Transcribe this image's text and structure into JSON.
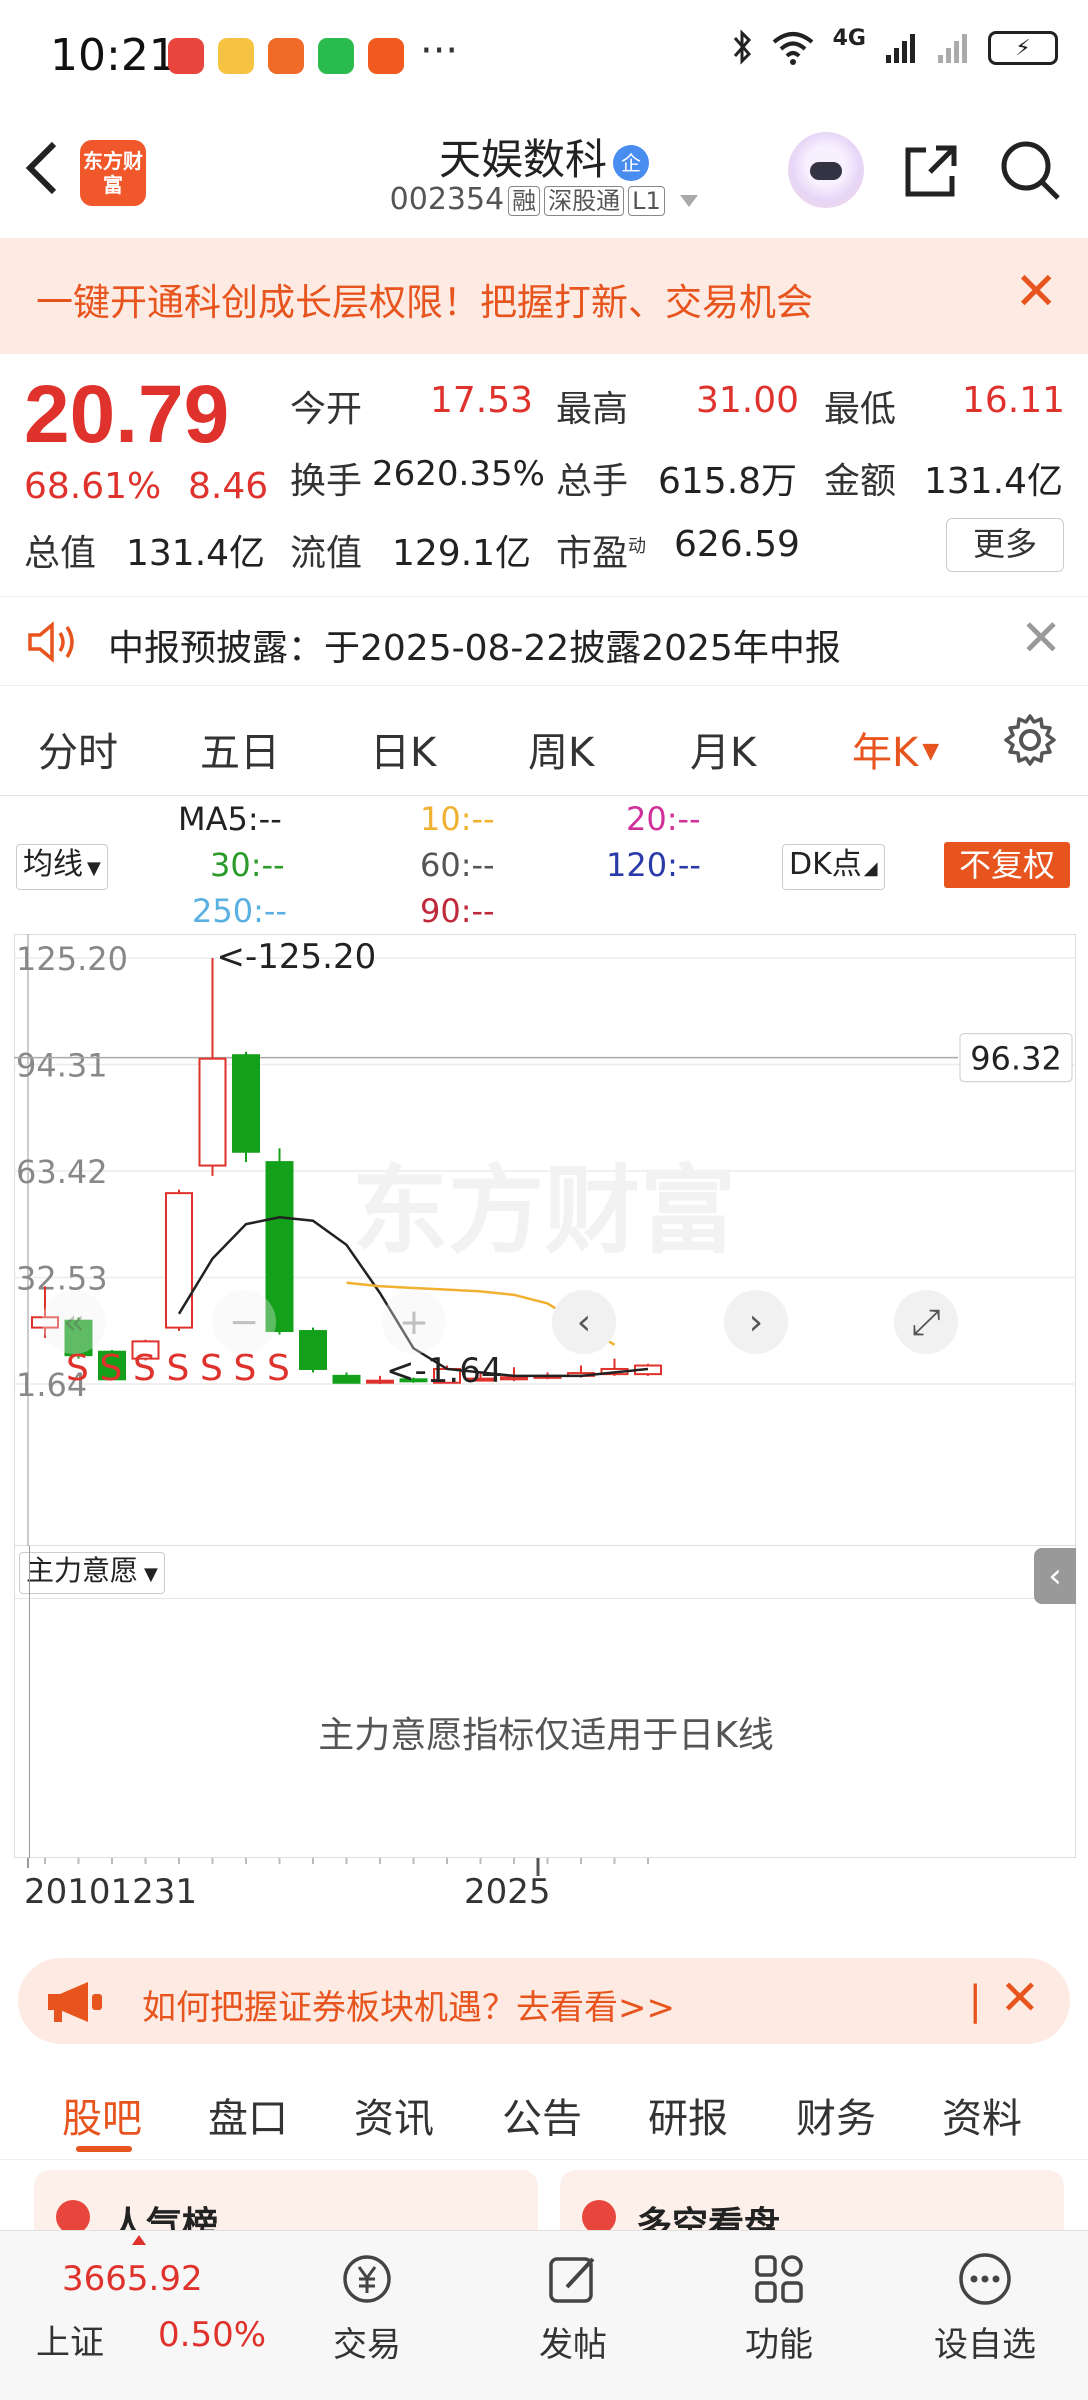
{
  "status_bar": {
    "time": "10:21",
    "more": "···",
    "network": "4G",
    "battery_icon": "battery-charging-icon"
  },
  "header": {
    "logo_text": "东方财富",
    "stock_name": "天娱数科",
    "enterprise_badge": "企",
    "stock_code": "002354",
    "tags": [
      "融",
      "深股通",
      "L1"
    ]
  },
  "banner": {
    "text": "一键开通科创成长层权限！把握打新、交易机会",
    "close": "✕"
  },
  "quote": {
    "price": "20.79",
    "change_pct": "68.61%",
    "change_amt": "8.46",
    "fields": [
      {
        "label": "今开",
        "value": "17.53"
      },
      {
        "label": "最高",
        "value": "31.00"
      },
      {
        "label": "最低",
        "value": "16.11"
      },
      {
        "label": "换手",
        "value": "2620.35%"
      },
      {
        "label": "总手",
        "value": "615.8万"
      },
      {
        "label": "金额",
        "value": "131.4亿"
      },
      {
        "label": "总值",
        "value": "131.4亿"
      },
      {
        "label": "流值",
        "value": "129.1亿"
      },
      {
        "label": "市盈",
        "sup": "动",
        "value": "626.59"
      }
    ],
    "more_label": "更多"
  },
  "notice": {
    "text": "中报预披露：于2025-08-22披露2025年中报",
    "close": "✕"
  },
  "period_tabs": [
    "分时",
    "五日",
    "日K",
    "周K",
    "月K",
    "年K"
  ],
  "active_tab": "年K",
  "ma_legend": {
    "ma5": "MA5:--",
    "ma10": "10:--",
    "ma20": "20:--",
    "ma30": "30:--",
    "ma60": "60:--",
    "ma120": "120:--",
    "ma250": "250:--",
    "ma90": "90:--",
    "colors": {
      "ma5": "#222222",
      "ma10": "#f0b030",
      "ma20": "#d0309a",
      "ma30": "#2a9a2a",
      "ma60": "#555555",
      "ma120": "#2a3aa8",
      "ma250": "#5ab0e0",
      "ma90": "#c0283c"
    }
  },
  "indicator_select": "均线",
  "dk_select": "DK点",
  "fuquan_label": "不复权",
  "chart_data": {
    "type": "candlestick",
    "y_ticks": [
      "125.20",
      "94.31",
      "63.42",
      "32.53",
      "1.64"
    ],
    "y_range": [
      1.64,
      125.2
    ],
    "max_label": "<-125.20",
    "min_label": "<-1.64",
    "current_line_value": "96.32",
    "x_labels": [
      "20101231",
      "2025"
    ],
    "candles": [
      {
        "open": 18.0,
        "close": 21.0,
        "high": 30.0,
        "low": 15.0
      },
      {
        "open": 20.0,
        "close": 10.0,
        "high": 21.0,
        "low": 9.0
      },
      {
        "open": 11.0,
        "close": 3.0,
        "high": 11.5,
        "low": 2.8
      },
      {
        "open": 9.0,
        "close": 14.0,
        "high": 14.5,
        "low": 8.5
      },
      {
        "open": 18.0,
        "close": 57.0,
        "high": 58.0,
        "low": 17.0
      },
      {
        "open": 65.0,
        "close": 96.0,
        "high": 125.2,
        "low": 62.0
      },
      {
        "open": 97.0,
        "close": 69.0,
        "high": 98.0,
        "low": 66.0
      },
      {
        "open": 66.0,
        "close": 17.0,
        "high": 70.0,
        "low": 16.0
      },
      {
        "open": 17.0,
        "close": 6.0,
        "high": 18.0,
        "low": 5.0
      },
      {
        "open": 4.0,
        "close": 2.0,
        "high": 5.0,
        "low": 1.8
      },
      {
        "open": 2.5,
        "close": 2.6,
        "high": 4.0,
        "low": 1.64
      },
      {
        "open": 3.0,
        "close": 2.6,
        "high": 3.5,
        "low": 2.0
      },
      {
        "open": 2.0,
        "close": 6.0,
        "high": 7.0,
        "low": 1.9
      },
      {
        "open": 3.0,
        "close": 3.2,
        "high": 5.0,
        "low": 2.6
      },
      {
        "open": 3.0,
        "close": 3.6,
        "high": 6.5,
        "low": 2.5
      },
      {
        "open": 3.5,
        "close": 4.0,
        "high": 5.0,
        "low": 3.0
      },
      {
        "open": 4.0,
        "close": 4.8,
        "high": 7.0,
        "low": 3.5
      },
      {
        "open": 4.5,
        "close": 6.0,
        "high": 9.0,
        "low": 4.0
      },
      {
        "open": 4.5,
        "close": 7.0,
        "high": 7.5,
        "low": 4.0
      }
    ],
    "ma_black": [
      null,
      null,
      null,
      null,
      22,
      38,
      48,
      50,
      49,
      42,
      28,
      12,
      6,
      5,
      4,
      4,
      4,
      5,
      6
    ],
    "ma_orange": [
      null,
      null,
      null,
      null,
      null,
      null,
      null,
      null,
      null,
      31,
      30,
      29.5,
      29,
      28.5,
      27.5,
      25,
      19,
      13,
      null
    ],
    "s_markers": "SSSSSSS",
    "watermark": "东方财富"
  },
  "sub_indicator": {
    "select": "主力意愿",
    "hint": "主力意愿指标仅适用于日K线"
  },
  "promo": {
    "text": "如何把握证券板块机遇？去看看>>",
    "close": "✕"
  },
  "bottom_tabs": [
    "股吧",
    "盘口",
    "资讯",
    "公告",
    "研报",
    "财务",
    "资料"
  ],
  "active_bottom_tab": "股吧",
  "cards": [
    "人气榜",
    "多空看盘"
  ],
  "nav": {
    "index_value": "3665.92",
    "index_name": "上证",
    "index_change": "0.50%",
    "items": [
      "交易",
      "发帖",
      "功能",
      "设自选"
    ]
  }
}
